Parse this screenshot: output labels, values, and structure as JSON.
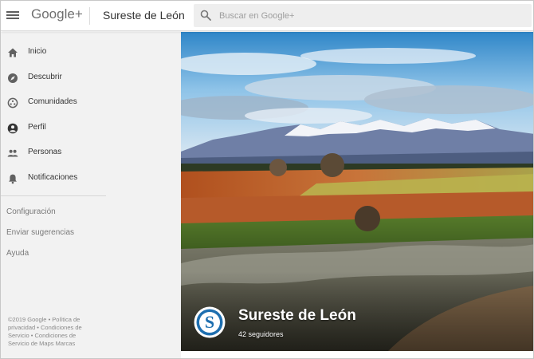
{
  "header": {
    "brand": "Google+",
    "page_name": "Sureste de León",
    "search_placeholder": "Buscar en Google+"
  },
  "sidebar": {
    "items": [
      {
        "label": "Inicio",
        "icon": "home-icon"
      },
      {
        "label": "Descubrir",
        "icon": "compass-icon"
      },
      {
        "label": "Comunidades",
        "icon": "communities-icon"
      },
      {
        "label": "Perfil",
        "icon": "profile-icon"
      },
      {
        "label": "Personas",
        "icon": "people-icon"
      },
      {
        "label": "Notificaciones",
        "icon": "bell-icon"
      }
    ],
    "secondary": [
      "Configuración",
      "Enviar sugerencias",
      "Ayuda"
    ],
    "footer": {
      "copyright": "©2019 Google",
      "links": [
        "Política de privacidad",
        "Condiciones de Servicio",
        "Condiciones de Servicio de Maps",
        "Marcas"
      ]
    }
  },
  "cover": {
    "title": "Sureste de León",
    "followers": "42 seguidores",
    "badge_letter": "S"
  },
  "colors": {
    "accent_blue": "#1e6fb0",
    "sidebar_bg": "#f2f2f2",
    "search_bg": "#eeeeee"
  }
}
